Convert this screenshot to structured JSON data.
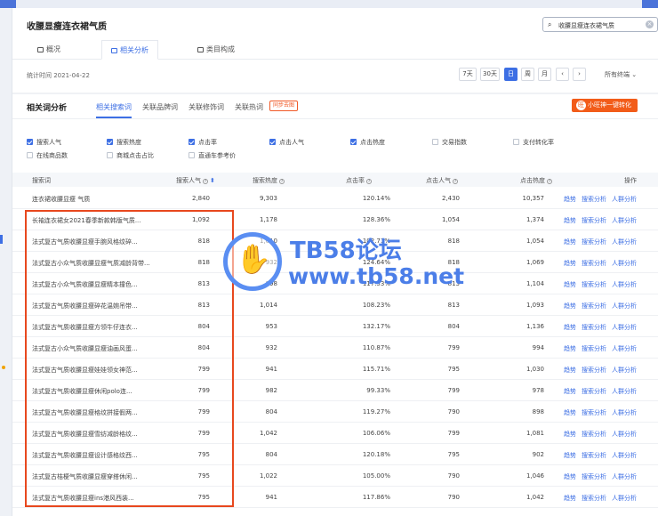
{
  "header": {
    "title": "收腰显瘦连衣裙气质",
    "search_value": "收腰显瘦连衣裙气质",
    "tabs": [
      "概况",
      "相关分析",
      "类目构成"
    ],
    "stat_time": "统计时间 2021-04-22",
    "ranges": [
      "7天",
      "30天",
      "日",
      "周",
      "月"
    ],
    "prev": "‹",
    "next": "›",
    "terminal": "所有终端 ⌄"
  },
  "panel": {
    "title": "相关词分析",
    "tabs": [
      "相关搜索词",
      "关联品牌词",
      "关联修饰词",
      "关联热词"
    ],
    "new_tag": "同步去图",
    "cta": "小旺神一键转化",
    "cta_icon": "旺",
    "metrics": [
      {
        "label": "搜索人气",
        "checked": true
      },
      {
        "label": "搜索热度",
        "checked": true
      },
      {
        "label": "点击率",
        "checked": true
      },
      {
        "label": "点击人气",
        "checked": true
      },
      {
        "label": "点击热度",
        "checked": true
      },
      {
        "label": "交易指数",
        "checked": false
      },
      {
        "label": "支付转化率",
        "checked": false
      },
      {
        "label": "在线商品数",
        "checked": false
      },
      {
        "label": "商城点击占比",
        "checked": false
      },
      {
        "label": "直通车参考价",
        "checked": false
      }
    ],
    "columns": [
      "搜索词",
      "搜索人气",
      "搜索热度",
      "点击率",
      "点击人气",
      "点击热度",
      "操作"
    ],
    "sort_icon": "⬍",
    "actions": [
      "趋势",
      "搜索分析",
      "人群分析"
    ],
    "rows": [
      [
        "连衣裙收腰显瘦 气质",
        "2,840",
        "9,303",
        "120.14%",
        "2,430",
        "10,357"
      ],
      [
        "长袖连衣裙女2021春季新款韩版气质...",
        "1,092",
        "1,178",
        "128.36%",
        "1,054",
        "1,374"
      ],
      [
        "法式复古气质收腰显瘦手腕风格纹碎...",
        "818",
        "1,010",
        "102.71%",
        "818",
        "1,054"
      ],
      [
        "法式复古小众气质收腰显瘦气质减龄背带...",
        "818",
        "932",
        "124.64%",
        "818",
        "1,069"
      ],
      [
        "法式复古小众气质收腰显瘦精本撞色...",
        "813",
        "998",
        "117.53%",
        "813",
        "1,104"
      ],
      [
        "法式复古气质收腰显瘦碎花温婉吊带...",
        "813",
        "1,014",
        "108.23%",
        "813",
        "1,093"
      ],
      [
        "法式复古气质收腰显瘦方领牛仔连衣...",
        "804",
        "953",
        "132.17%",
        "804",
        "1,136"
      ],
      [
        "法式复古小众气质收腰显瘦油画风蛋...",
        "804",
        "932",
        "110.87%",
        "799",
        "994"
      ],
      [
        "法式复古气质收腰显瘦娃娃领女神范...",
        "799",
        "941",
        "115.71%",
        "795",
        "1,030"
      ],
      [
        "法式复古气质收腰显瘦休闲polo连...",
        "799",
        "982",
        "99.33%",
        "799",
        "978"
      ],
      [
        "法式复古气质收腰显瘦格纹拼接假两...",
        "799",
        "804",
        "119.27%",
        "790",
        "898"
      ],
      [
        "法式复古气质收腰显瘦雪纺减龄格纹...",
        "799",
        "1,042",
        "106.06%",
        "799",
        "1,081"
      ],
      [
        "法式复古气质收腰显瘦设计感格纹西...",
        "795",
        "804",
        "120.18%",
        "795",
        "902"
      ],
      [
        "法式复古桔梗气质收腰显瘦穿搭休闲...",
        "795",
        "1,022",
        "105.00%",
        "790",
        "1,046"
      ],
      [
        "法式复古气质收腰显瘦ins港风西装...",
        "795",
        "941",
        "117.86%",
        "790",
        "1,042"
      ]
    ]
  },
  "watermark": {
    "title": "TB58论坛",
    "url": "www.tb58.net",
    "hand": "✋"
  },
  "colors": {
    "accent": "#3d6fe4",
    "cta": "#f25c19",
    "highlight_box": "#e8481e"
  }
}
